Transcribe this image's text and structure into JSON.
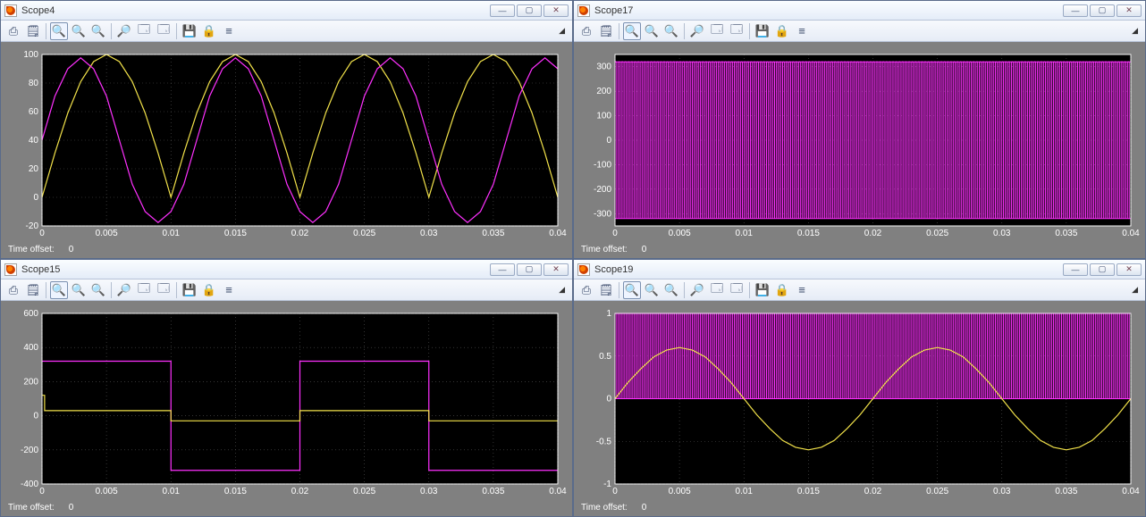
{
  "toolbar": {
    "print": "⎙",
    "params": "🗒",
    "zoom": "🔍",
    "zoomx": "🔍",
    "zoomy": "🔍",
    "find": "🔎",
    "cfg1": "🗔",
    "cfg2": "🗔",
    "save": "💾",
    "lock": "🔒",
    "sync": "≡"
  },
  "scopes": [
    {
      "title": "Scope4",
      "time_offset_label": "Time offset:",
      "time_offset_value": "0",
      "x_ticks": [
        "0",
        "0.005",
        "0.01",
        "0.015",
        "0.02",
        "0.025",
        "0.03",
        "0.035",
        "0.04"
      ],
      "y_ticks": [
        "-20",
        "0",
        "20",
        "40",
        "60",
        "80",
        "100"
      ],
      "chart_data": {
        "type": "line",
        "xlabel": "",
        "ylabel": "",
        "xlim": [
          0,
          0.04
        ],
        "ylim": [
          -20,
          100
        ],
        "series": [
          {
            "name": "abs-sine-yellow",
            "color": "#f2e24a",
            "x": [
              0,
              0.001,
              0.002,
              0.003,
              0.004,
              0.005,
              0.006,
              0.007,
              0.008,
              0.009,
              0.01,
              0.011,
              0.012,
              0.013,
              0.014,
              0.015,
              0.016,
              0.017,
              0.018,
              0.019,
              0.02,
              0.021,
              0.022,
              0.023,
              0.024,
              0.025,
              0.026,
              0.027,
              0.028,
              0.029,
              0.03,
              0.031,
              0.032,
              0.033,
              0.034,
              0.035,
              0.036,
              0.037,
              0.038,
              0.039,
              0.04
            ],
            "y": [
              0,
              31,
              59,
              81,
              95,
              100,
              95,
              81,
              59,
              31,
              0,
              31,
              59,
              81,
              95,
              100,
              95,
              81,
              59,
              31,
              0,
              31,
              59,
              81,
              95,
              100,
              95,
              81,
              59,
              31,
              0,
              31,
              59,
              81,
              95,
              100,
              95,
              81,
              59,
              31,
              0
            ]
          },
          {
            "name": "sine-shifted-magenta",
            "color": "#ff30ff",
            "x": [
              0,
              0.001,
              0.002,
              0.003,
              0.004,
              0.005,
              0.006,
              0.007,
              0.008,
              0.009,
              0.01,
              0.011,
              0.012,
              0.013,
              0.014,
              0.015,
              0.016,
              0.017,
              0.018,
              0.019,
              0.02,
              0.021,
              0.022,
              0.023,
              0.024,
              0.025,
              0.026,
              0.027,
              0.028,
              0.029,
              0.03,
              0.031,
              0.032,
              0.033,
              0.034,
              0.035,
              0.036,
              0.037,
              0.038,
              0.039,
              0.04
            ],
            "y": [
              40,
              70.9,
              90,
              97.6,
              90,
              70.9,
              40,
              9.1,
              -10,
              -17.6,
              -10,
              9.1,
              40,
              70.9,
              90,
              97.6,
              90,
              70.9,
              40,
              9.1,
              -10,
              -17.6,
              -10,
              9.1,
              40,
              70.9,
              90,
              97.6,
              90,
              70.9,
              40,
              9.1,
              -10,
              -17.6,
              -10,
              9.1,
              40,
              70.9,
              90,
              97.6,
              90
            ]
          }
        ]
      }
    },
    {
      "title": "Scope17",
      "time_offset_label": "Time offset:",
      "time_offset_value": "0",
      "x_ticks": [
        "0",
        "0.005",
        "0.01",
        "0.015",
        "0.02",
        "0.025",
        "0.03",
        "0.035",
        "0.04"
      ],
      "y_ticks": [
        "-300",
        "-200",
        "-100",
        "0",
        "100",
        "200",
        "300"
      ],
      "chart_data": {
        "type": "line",
        "xlabel": "",
        "ylabel": "",
        "xlim": [
          0,
          0.04
        ],
        "ylim": [
          -350,
          350
        ],
        "note": "High-frequency PWM voltage switching between approx -320 and +320; rendered as dense vertical strokes.",
        "series": [
          {
            "name": "pwm-magenta",
            "color": "#ff30ff",
            "pwm": true,
            "pwm_hi": 320,
            "pwm_lo": -320,
            "pulses": 160
          }
        ]
      }
    },
    {
      "title": "Scope15",
      "time_offset_label": "Time offset:",
      "time_offset_value": "0",
      "x_ticks": [
        "0",
        "0.005",
        "0.01",
        "0.015",
        "0.02",
        "0.025",
        "0.03",
        "0.035",
        "0.04"
      ],
      "y_ticks": [
        "-400",
        "-200",
        "0",
        "200",
        "400",
        "600"
      ],
      "chart_data": {
        "type": "line",
        "xlabel": "",
        "ylabel": "",
        "xlim": [
          0,
          0.04
        ],
        "ylim": [
          -400,
          600
        ],
        "series": [
          {
            "name": "square-magenta",
            "color": "#ff30ff",
            "x": [
              0,
              0.01,
              0.01,
              0.02,
              0.02,
              0.03,
              0.03,
              0.04
            ],
            "y": [
              320,
              320,
              -320,
              -320,
              320,
              320,
              -320,
              -320
            ]
          },
          {
            "name": "square-yellow",
            "color": "#f2e24a",
            "x": [
              0,
              0.0002,
              0.0002,
              0.01,
              0.01,
              0.02,
              0.02,
              0.03,
              0.03,
              0.04
            ],
            "y": [
              120,
              120,
              30,
              30,
              -30,
              -30,
              30,
              30,
              -30,
              -30
            ]
          }
        ]
      }
    },
    {
      "title": "Scope19",
      "time_offset_label": "Time offset:",
      "time_offset_value": "0",
      "x_ticks": [
        "0",
        "0.005",
        "0.01",
        "0.015",
        "0.02",
        "0.025",
        "0.03",
        "0.035",
        "0.04"
      ],
      "y_ticks": [
        "-1",
        "-0.5",
        "0",
        "0.5",
        "1"
      ],
      "chart_data": {
        "type": "line",
        "xlabel": "",
        "ylabel": "",
        "xlim": [
          0,
          0.04
        ],
        "ylim": [
          -1,
          1
        ],
        "series": [
          {
            "name": "pwm-magenta",
            "color": "#ff30ff",
            "pwm": true,
            "pwm_hi": 1,
            "pwm_lo": 0,
            "pulses": 160
          },
          {
            "name": "sine-yellow",
            "color": "#f2e24a",
            "x": [
              0,
              0.001,
              0.002,
              0.003,
              0.004,
              0.005,
              0.006,
              0.007,
              0.008,
              0.009,
              0.01,
              0.011,
              0.012,
              0.013,
              0.014,
              0.015,
              0.016,
              0.017,
              0.018,
              0.019,
              0.02,
              0.021,
              0.022,
              0.023,
              0.024,
              0.025,
              0.026,
              0.027,
              0.028,
              0.029,
              0.03,
              0.031,
              0.032,
              0.033,
              0.034,
              0.035,
              0.036,
              0.037,
              0.038,
              0.039,
              0.04
            ],
            "y": [
              0,
              0.19,
              0.35,
              0.49,
              0.57,
              0.6,
              0.57,
              0.49,
              0.35,
              0.19,
              0,
              -0.19,
              -0.35,
              -0.49,
              -0.57,
              -0.6,
              -0.57,
              -0.49,
              -0.35,
              -0.19,
              0,
              0.19,
              0.35,
              0.49,
              0.57,
              0.6,
              0.57,
              0.49,
              0.35,
              0.19,
              0,
              -0.19,
              -0.35,
              -0.49,
              -0.57,
              -0.6,
              -0.57,
              -0.49,
              -0.35,
              -0.19,
              0
            ]
          }
        ]
      }
    }
  ]
}
